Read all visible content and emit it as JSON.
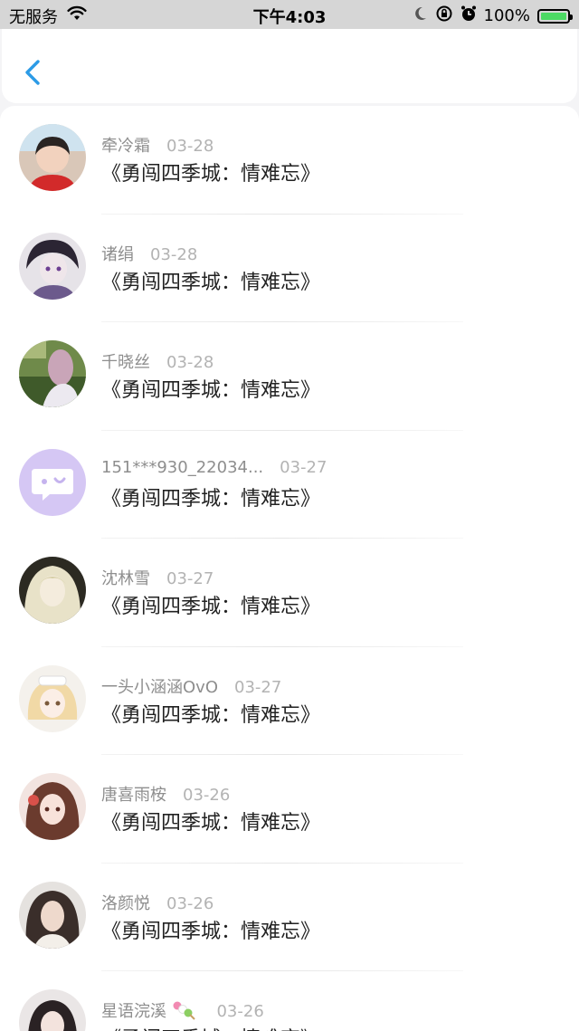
{
  "status_bar": {
    "carrier": "无服务",
    "time": "下午4:03",
    "battery": "100%",
    "battery_level": 1.0,
    "icons": [
      "wifi-icon",
      "moon-icon",
      "rotation-lock-icon",
      "alarm-icon",
      "battery-icon"
    ]
  },
  "nav": {
    "back_icon": "chevron-left-icon",
    "accent_color": "#2c9be6"
  },
  "items": [
    {
      "name": "牵冷霜",
      "date": "03-28",
      "title": "《勇闯四季城：情难忘》"
    },
    {
      "name": "诸绢",
      "date": "03-28",
      "title": "《勇闯四季城：情难忘》"
    },
    {
      "name": "千晓丝",
      "date": "03-28",
      "title": "《勇闯四季城：情难忘》"
    },
    {
      "name": "151***930_22034...",
      "date": "03-27",
      "title": "《勇闯四季城：情难忘》"
    },
    {
      "name": "沈林雪",
      "date": "03-27",
      "title": "《勇闯四季城：情难忘》"
    },
    {
      "name": "一头小涵涵OvO",
      "date": "03-27",
      "title": "《勇闯四季城：情难忘》"
    },
    {
      "name": "唐喜雨桉",
      "date": "03-26",
      "title": "《勇闯四季城：情难忘》"
    },
    {
      "name": "洛颜悦",
      "date": "03-26",
      "title": "《勇闯四季城：情难忘》"
    },
    {
      "name": "星语浣溪",
      "date": "03-26",
      "title": "《勇闯四季城：情难忘》"
    }
  ]
}
